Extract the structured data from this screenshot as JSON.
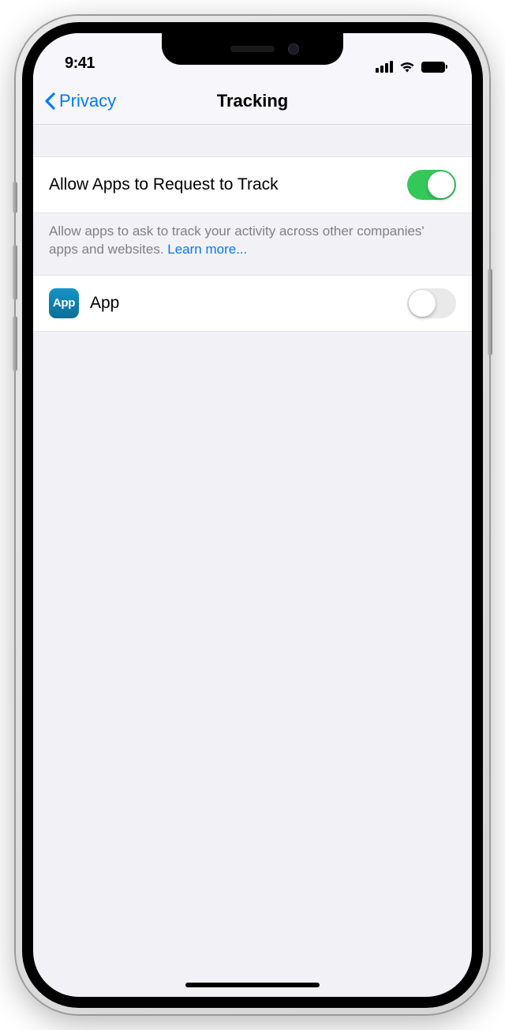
{
  "status": {
    "time": "9:41"
  },
  "nav": {
    "back_label": "Privacy",
    "title": "Tracking"
  },
  "main_row": {
    "label": "Allow Apps to Request to Track",
    "enabled": true
  },
  "footer": {
    "text": "Allow apps to ask to track your activity across other companies' apps and websites. ",
    "learn_more": "Learn more..."
  },
  "apps": [
    {
      "icon_text": "App",
      "name": "App",
      "enabled": false
    }
  ]
}
